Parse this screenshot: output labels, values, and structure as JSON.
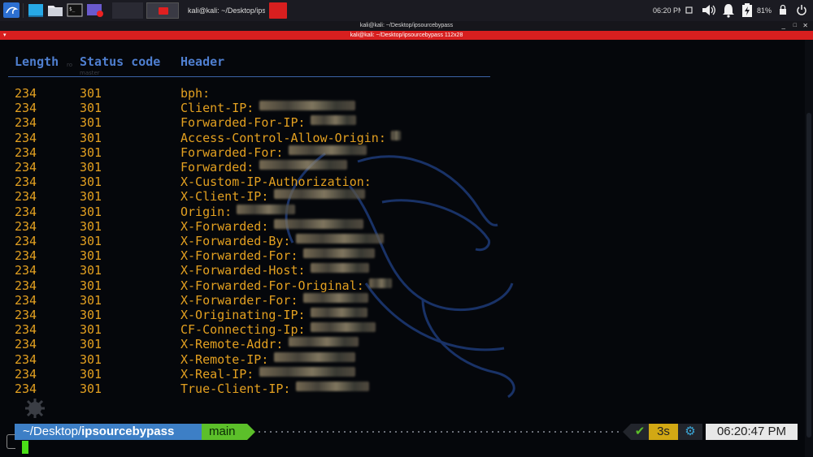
{
  "taskbar": {
    "window_title": "kali@kali: ~/Desktop/ips",
    "time": "06:20 PM",
    "battery": "81%"
  },
  "window": {
    "title": "kali@kali: ~/Desktop/ipsourcebypass",
    "tab_title": "kali@kali: ~/Desktop/ipsourcebypass 112x28"
  },
  "table": {
    "headers": [
      "Length",
      "Status code",
      "Header"
    ],
    "rows": [
      {
        "length": "234",
        "status": "301",
        "header": "bph:"
      },
      {
        "length": "234",
        "status": "301",
        "header": "Client-IP:"
      },
      {
        "length": "234",
        "status": "301",
        "header": "Forwarded-For-IP:"
      },
      {
        "length": "234",
        "status": "301",
        "header": "Access-Control-Allow-Origin:"
      },
      {
        "length": "234",
        "status": "301",
        "header": "Forwarded-For:"
      },
      {
        "length": "234",
        "status": "301",
        "header": "Forwarded:"
      },
      {
        "length": "234",
        "status": "301",
        "header": "X-Custom-IP-Authorization:"
      },
      {
        "length": "234",
        "status": "301",
        "header": "X-Client-IP:"
      },
      {
        "length": "234",
        "status": "301",
        "header": "Origin:"
      },
      {
        "length": "234",
        "status": "301",
        "header": "X-Forwarded:"
      },
      {
        "length": "234",
        "status": "301",
        "header": "X-Forwarded-By:"
      },
      {
        "length": "234",
        "status": "301",
        "header": "X-Forwarded-For:"
      },
      {
        "length": "234",
        "status": "301",
        "header": "X-Forwarded-Host:"
      },
      {
        "length": "234",
        "status": "301",
        "header": "X-Forwarded-For-Original:"
      },
      {
        "length": "234",
        "status": "301",
        "header": "X-Forwarder-For:"
      },
      {
        "length": "234",
        "status": "301",
        "header": "X-Originating-IP:"
      },
      {
        "length": "234",
        "status": "301",
        "header": "CF-Connecting-Ip:"
      },
      {
        "length": "234",
        "status": "301",
        "header": "X-Remote-Addr:"
      },
      {
        "length": "234",
        "status": "301",
        "header": "X-Remote-IP:"
      },
      {
        "length": "234",
        "status": "301",
        "header": "X-Real-IP:"
      },
      {
        "length": "234",
        "status": "301",
        "header": "True-Client-IP:"
      }
    ]
  },
  "prompt": {
    "path_prefix": "~/Desktop/",
    "path_dir": "ipsourcebypass",
    "branch": "main",
    "status_ok": "✔",
    "duration": "3s",
    "clock": "06:20:47 PM"
  },
  "colors": {
    "accent_blue": "#4f7fd0",
    "row_orange": "#e3a020",
    "prompt_path_bg": "#3d7fc6",
    "prompt_branch_bg": "#5cbf2a",
    "kali_red": "#d81f1f"
  }
}
